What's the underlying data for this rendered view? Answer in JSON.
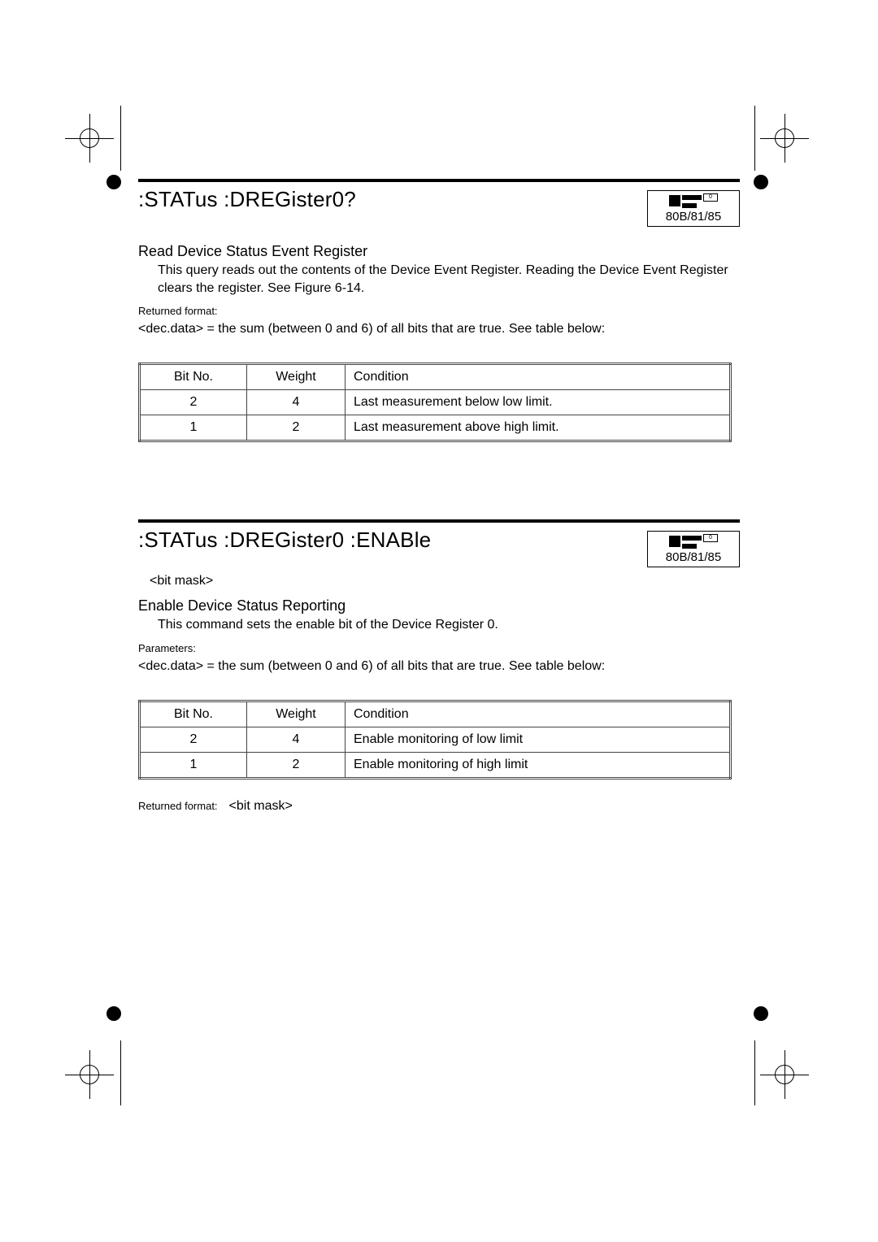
{
  "device_label": "80B/81/85",
  "section1": {
    "title": ":STATus :DREGister0?",
    "subhead": "Read Device Status Event Register",
    "desc": "This query reads out the contents of the Device Event Register. Reading the Device Event Register clears the register. See Figure 6-14.",
    "ret_label": "Returned format:",
    "ret_body": "<dec.data> = the sum (between 0 and 6) of all bits that are true. See table below:",
    "table": {
      "headers": [
        "Bit No.",
        "Weight",
        "Condition"
      ],
      "rows": [
        {
          "bit": "2",
          "weight": "4",
          "cond": "Last measurement below low limit."
        },
        {
          "bit": "1",
          "weight": "2",
          "cond": "Last measurement above high limit."
        }
      ]
    }
  },
  "section2": {
    "title": ":STATus :DREGister0 :ENABle",
    "arg": "<bit mask>",
    "subhead": "Enable Device Status Reporting",
    "desc": "This command sets the enable bit of the Device Register 0.",
    "param_label": "Parameters:",
    "param_body": "<dec.data> = the sum (between 0 and 6) of all bits that are true. See table below:",
    "table": {
      "headers": [
        "Bit No.",
        "Weight",
        "Condition"
      ],
      "rows": [
        {
          "bit": "2",
          "weight": "4",
          "cond": "Enable monitoring of low limit"
        },
        {
          "bit": "1",
          "weight": "2",
          "cond": "Enable monitoring of high limit"
        }
      ]
    },
    "ret_label": "Returned format:",
    "ret_body": "<bit mask>"
  }
}
